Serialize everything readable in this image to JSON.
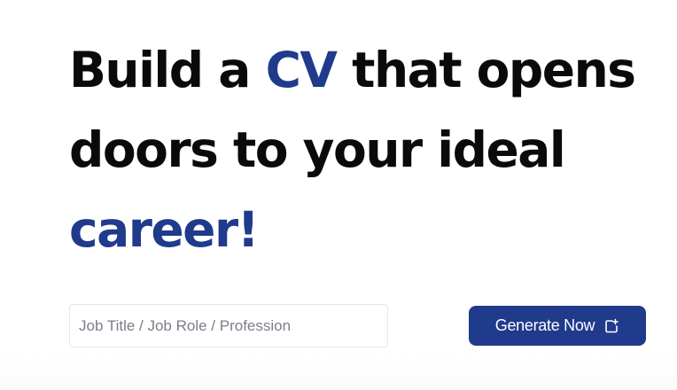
{
  "hero": {
    "headline": {
      "line1_prefix": "Build a ",
      "line1_accent": "CV",
      "line1_suffix": " that opens",
      "line2": "doors to your ideal",
      "line3_accent": "career!"
    },
    "accent_color": "#203a8c"
  },
  "form": {
    "job_input": {
      "placeholder": "Job Title / Job Role / Profession",
      "value": ""
    },
    "generate_button": {
      "label": "Generate Now",
      "icon": "add-document-icon",
      "color": "#203a8c"
    }
  }
}
